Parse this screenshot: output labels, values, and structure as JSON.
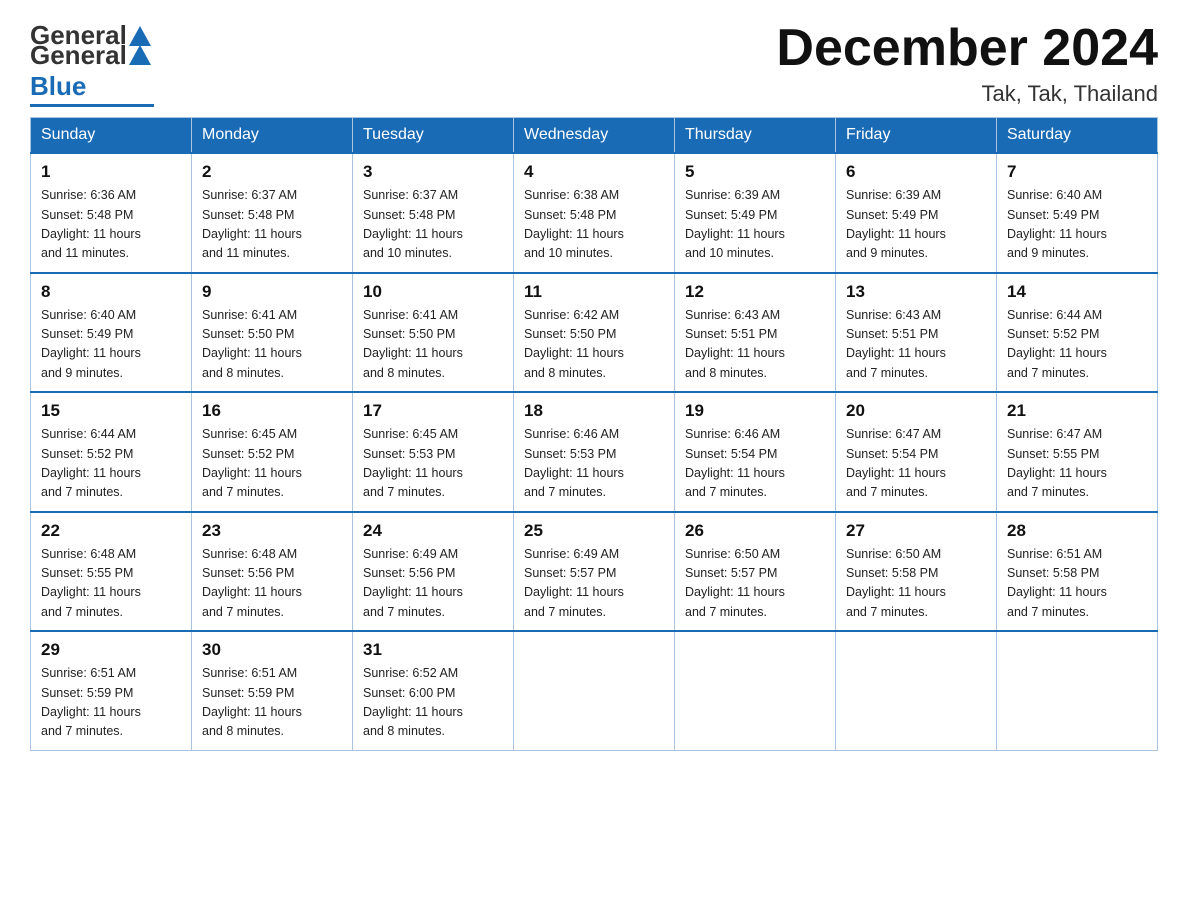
{
  "logo": {
    "text_general": "General",
    "text_blue": "Blue"
  },
  "title": "December 2024",
  "location": "Tak, Tak, Thailand",
  "days_of_week": [
    "Sunday",
    "Monday",
    "Tuesday",
    "Wednesday",
    "Thursday",
    "Friday",
    "Saturday"
  ],
  "weeks": [
    [
      {
        "day": "1",
        "sunrise": "6:36 AM",
        "sunset": "5:48 PM",
        "daylight": "11 hours and 11 minutes."
      },
      {
        "day": "2",
        "sunrise": "6:37 AM",
        "sunset": "5:48 PM",
        "daylight": "11 hours and 11 minutes."
      },
      {
        "day": "3",
        "sunrise": "6:37 AM",
        "sunset": "5:48 PM",
        "daylight": "11 hours and 10 minutes."
      },
      {
        "day": "4",
        "sunrise": "6:38 AM",
        "sunset": "5:48 PM",
        "daylight": "11 hours and 10 minutes."
      },
      {
        "day": "5",
        "sunrise": "6:39 AM",
        "sunset": "5:49 PM",
        "daylight": "11 hours and 10 minutes."
      },
      {
        "day": "6",
        "sunrise": "6:39 AM",
        "sunset": "5:49 PM",
        "daylight": "11 hours and 9 minutes."
      },
      {
        "day": "7",
        "sunrise": "6:40 AM",
        "sunset": "5:49 PM",
        "daylight": "11 hours and 9 minutes."
      }
    ],
    [
      {
        "day": "8",
        "sunrise": "6:40 AM",
        "sunset": "5:49 PM",
        "daylight": "11 hours and 9 minutes."
      },
      {
        "day": "9",
        "sunrise": "6:41 AM",
        "sunset": "5:50 PM",
        "daylight": "11 hours and 8 minutes."
      },
      {
        "day": "10",
        "sunrise": "6:41 AM",
        "sunset": "5:50 PM",
        "daylight": "11 hours and 8 minutes."
      },
      {
        "day": "11",
        "sunrise": "6:42 AM",
        "sunset": "5:50 PM",
        "daylight": "11 hours and 8 minutes."
      },
      {
        "day": "12",
        "sunrise": "6:43 AM",
        "sunset": "5:51 PM",
        "daylight": "11 hours and 8 minutes."
      },
      {
        "day": "13",
        "sunrise": "6:43 AM",
        "sunset": "5:51 PM",
        "daylight": "11 hours and 7 minutes."
      },
      {
        "day": "14",
        "sunrise": "6:44 AM",
        "sunset": "5:52 PM",
        "daylight": "11 hours and 7 minutes."
      }
    ],
    [
      {
        "day": "15",
        "sunrise": "6:44 AM",
        "sunset": "5:52 PM",
        "daylight": "11 hours and 7 minutes."
      },
      {
        "day": "16",
        "sunrise": "6:45 AM",
        "sunset": "5:52 PM",
        "daylight": "11 hours and 7 minutes."
      },
      {
        "day": "17",
        "sunrise": "6:45 AM",
        "sunset": "5:53 PM",
        "daylight": "11 hours and 7 minutes."
      },
      {
        "day": "18",
        "sunrise": "6:46 AM",
        "sunset": "5:53 PM",
        "daylight": "11 hours and 7 minutes."
      },
      {
        "day": "19",
        "sunrise": "6:46 AM",
        "sunset": "5:54 PM",
        "daylight": "11 hours and 7 minutes."
      },
      {
        "day": "20",
        "sunrise": "6:47 AM",
        "sunset": "5:54 PM",
        "daylight": "11 hours and 7 minutes."
      },
      {
        "day": "21",
        "sunrise": "6:47 AM",
        "sunset": "5:55 PM",
        "daylight": "11 hours and 7 minutes."
      }
    ],
    [
      {
        "day": "22",
        "sunrise": "6:48 AM",
        "sunset": "5:55 PM",
        "daylight": "11 hours and 7 minutes."
      },
      {
        "day": "23",
        "sunrise": "6:48 AM",
        "sunset": "5:56 PM",
        "daylight": "11 hours and 7 minutes."
      },
      {
        "day": "24",
        "sunrise": "6:49 AM",
        "sunset": "5:56 PM",
        "daylight": "11 hours and 7 minutes."
      },
      {
        "day": "25",
        "sunrise": "6:49 AM",
        "sunset": "5:57 PM",
        "daylight": "11 hours and 7 minutes."
      },
      {
        "day": "26",
        "sunrise": "6:50 AM",
        "sunset": "5:57 PM",
        "daylight": "11 hours and 7 minutes."
      },
      {
        "day": "27",
        "sunrise": "6:50 AM",
        "sunset": "5:58 PM",
        "daylight": "11 hours and 7 minutes."
      },
      {
        "day": "28",
        "sunrise": "6:51 AM",
        "sunset": "5:58 PM",
        "daylight": "11 hours and 7 minutes."
      }
    ],
    [
      {
        "day": "29",
        "sunrise": "6:51 AM",
        "sunset": "5:59 PM",
        "daylight": "11 hours and 7 minutes."
      },
      {
        "day": "30",
        "sunrise": "6:51 AM",
        "sunset": "5:59 PM",
        "daylight": "11 hours and 8 minutes."
      },
      {
        "day": "31",
        "sunrise": "6:52 AM",
        "sunset": "6:00 PM",
        "daylight": "11 hours and 8 minutes."
      },
      null,
      null,
      null,
      null
    ]
  ],
  "labels": {
    "sunrise": "Sunrise:",
    "sunset": "Sunset:",
    "daylight": "Daylight:"
  }
}
